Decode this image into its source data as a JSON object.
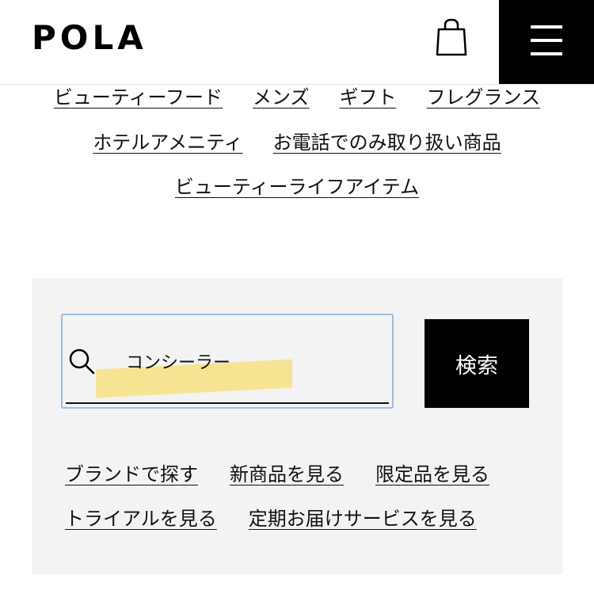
{
  "header": {
    "logo": "POLA",
    "icons": {
      "cart": "shopping-bag-icon",
      "menu": "hamburger-menu-icon"
    }
  },
  "categories": {
    "row1": [
      "ビューティーフード",
      "メンズ",
      "ギフト",
      "フレグランス"
    ],
    "row2": [
      "ホテルアメニティ",
      "お電話でのみ取り扱い商品"
    ],
    "row3": [
      "ビューティーライフアイテム"
    ]
  },
  "search": {
    "value": "コンシーラー",
    "button_label": "検索",
    "icon": "search-icon",
    "highlight_color": "#f7e38d",
    "focus_border_color": "#9dbbe3"
  },
  "quick_links": {
    "row1": [
      "ブランドで探す",
      "新商品を見る",
      "限定品を見る"
    ],
    "row2": [
      "トライアルを見る",
      "定期お届けサービスを見る"
    ]
  },
  "colors": {
    "panel_bg": "#f3f3f4",
    "button_bg": "#000000",
    "text": "#111111"
  }
}
